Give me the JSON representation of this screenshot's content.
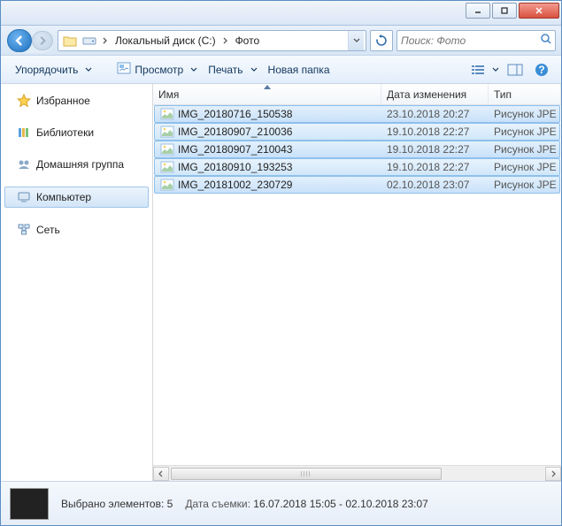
{
  "breadcrumb": {
    "segments": [
      "Локальный диск (C:)",
      "Фото"
    ]
  },
  "search": {
    "placeholder": "Поиск: Фото"
  },
  "toolbar": {
    "organize": "Упорядочить",
    "preview": "Просмотр",
    "print": "Печать",
    "newfolder": "Новая папка"
  },
  "sidebar": {
    "favorites": "Избранное",
    "libraries": "Библиотеки",
    "homegroup": "Домашняя группа",
    "computer": "Компьютер",
    "network": "Сеть"
  },
  "columns": {
    "name": "Имя",
    "date": "Дата изменения",
    "type": "Тип"
  },
  "files": [
    {
      "name": "IMG_20180716_150538",
      "date": "23.10.2018 20:27",
      "type": "Рисунок JPE"
    },
    {
      "name": "IMG_20180907_210036",
      "date": "19.10.2018 22:27",
      "type": "Рисунок JPE"
    },
    {
      "name": "IMG_20180907_210043",
      "date": "19.10.2018 22:27",
      "type": "Рисунок JPE"
    },
    {
      "name": "IMG_20180910_193253",
      "date": "19.10.2018 22:27",
      "type": "Рисунок JPE"
    },
    {
      "name": "IMG_20181002_230729",
      "date": "02.10.2018 23:07",
      "type": "Рисунок JPE"
    }
  ],
  "status": {
    "selected": "Выбрано элементов: 5",
    "date_label": "Дата съемки:",
    "date_value": "16.07.2018 15:05 - 02.10.2018 23:07"
  }
}
